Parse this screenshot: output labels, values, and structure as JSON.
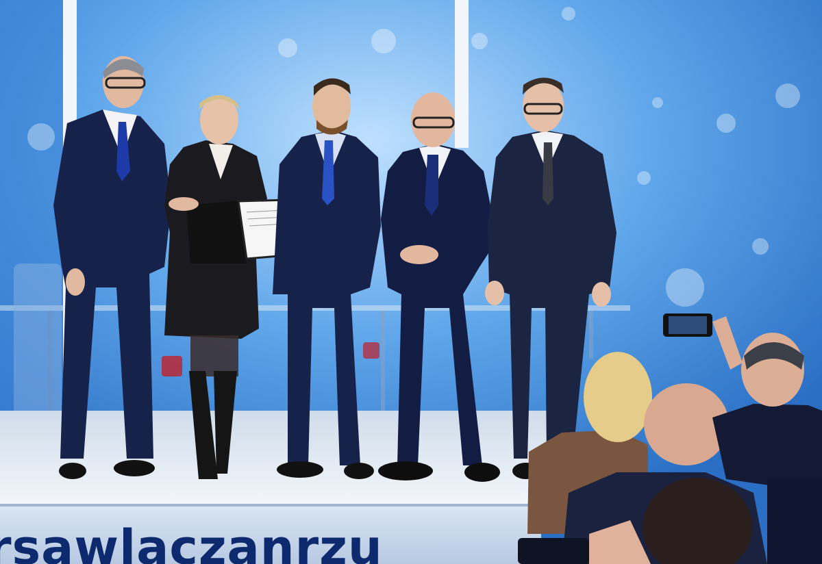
{
  "photo": {
    "banner_text": "rsawlaczanrzu",
    "colors": {
      "screen_bg": "#3f8fe0",
      "screen_glow": "#a9d4fb",
      "stage_floor": "#e7eef6",
      "banner_bg": "#c9d8ec",
      "banner_text": "#0d2a6e",
      "suit_navy": "#17224a",
      "dress_black": "#1b1b1f",
      "audience_dark": "#1b2340"
    },
    "people_on_stage": 5,
    "audience_visible": 4
  }
}
